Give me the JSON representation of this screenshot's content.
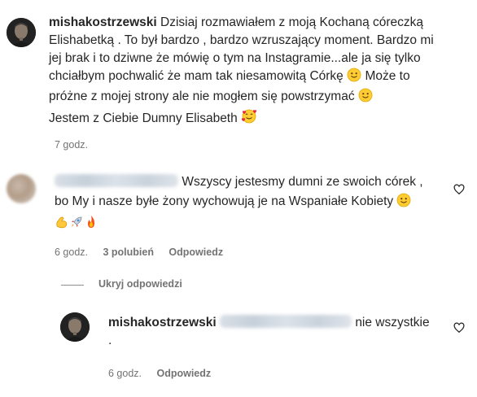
{
  "caption": {
    "username": "mishakostrzewski",
    "text_line1": "Dzisiaj rozmawiałem z moją Kochaną córeczką",
    "text_line2": "Elishabetką . To był bardzo , bardzo wzruszający moment. Bardzo mi",
    "text_line3": "jej brak i to dziwne że mówię o tym na Instagramie...ale ja się tylko",
    "text_line4a": "chciałbym pochwalić że mam tak niesamowitą Córkę",
    "text_line4b": "Może to",
    "text_line5": "próżne z mojej strony ale nie mogłem się powstrzymać",
    "text_line6": "Jestem z Ciebie Dumny Elisabeth",
    "time": "7 godz."
  },
  "comment": {
    "text_line1": "Wszyscy jestesmy dumni ze swoich córek ,",
    "text_line2": "bo My i nasze byłe żony wychowują je na Wspaniałe Kobiety",
    "time": "6 godz.",
    "likes": "3 polubień",
    "reply_label": "Odpowiedz",
    "hide_replies": "Ukryj odpowiedzi"
  },
  "reply": {
    "username": "mishakostrzewski",
    "text_tail": "nie wszystkie",
    "text_line2": ".",
    "time": "6 godz.",
    "reply_label": "Odpowiedz"
  },
  "icons": {
    "smile": "slightly-smiling-face-emoji",
    "heart_eyes": "smiling-face-with-hearts-emoji",
    "muscle": "flexed-biceps-emoji",
    "rocket": "rocket-emoji",
    "fire": "fire-emoji",
    "like": "heart-outline-icon"
  }
}
